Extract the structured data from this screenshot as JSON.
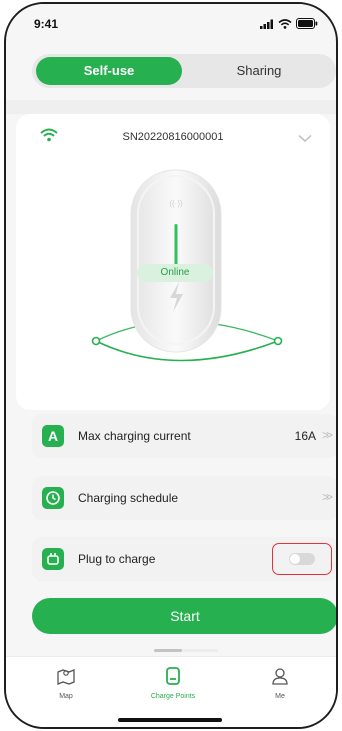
{
  "status_bar": {
    "time": "9:41",
    "icons": [
      "signal-icon",
      "wifi-icon",
      "battery-icon"
    ]
  },
  "segment": {
    "options": [
      "Self-use",
      "Sharing"
    ],
    "selected": "Self-use"
  },
  "device": {
    "serial": "SN20220816000001",
    "status": "Online",
    "connection_icon": "wifi-icon"
  },
  "settings": {
    "max_current": {
      "icon_letter": "A",
      "label": "Max charging current",
      "value": "16A"
    },
    "schedule": {
      "label": "Charging schedule"
    },
    "plug_to_charge": {
      "label": "Plug to charge",
      "enabled": false
    }
  },
  "actions": {
    "start_label": "Start"
  },
  "tabbar": {
    "tabs": [
      {
        "label": "Map",
        "icon": "map-icon"
      },
      {
        "label": "Charge Points",
        "icon": "charger-icon"
      },
      {
        "label": "Me",
        "icon": "person-icon"
      }
    ],
    "active": "Charge Points"
  },
  "colors": {
    "accent": "#27b04f",
    "highlight_border": "#e2343a"
  }
}
